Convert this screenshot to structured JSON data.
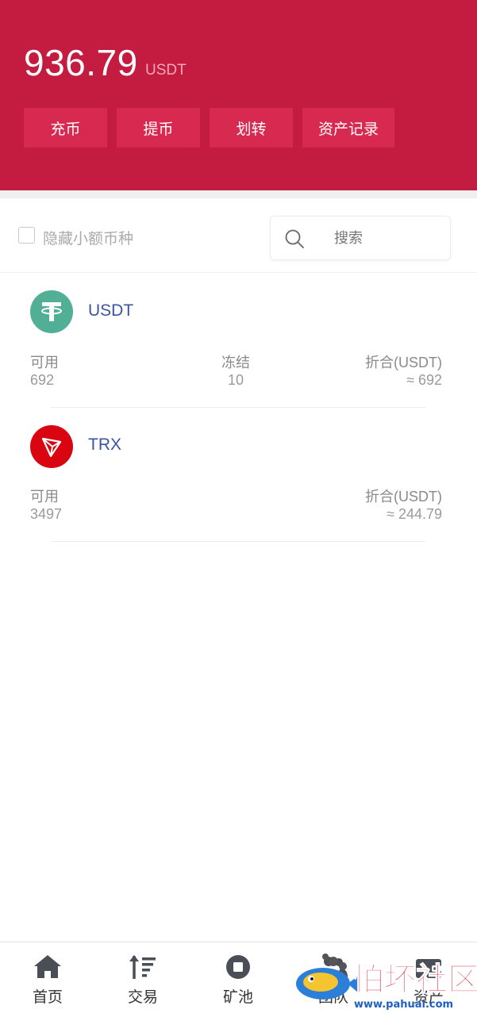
{
  "header": {
    "balance": "936.79",
    "balance_unit": "USDT",
    "buttons": [
      {
        "label": "充币"
      },
      {
        "label": "提币"
      },
      {
        "label": "划转"
      },
      {
        "label": "资产记录"
      }
    ]
  },
  "filter": {
    "hide_small_label": "隐藏小额币种",
    "search_placeholder": "搜索"
  },
  "assets": [
    {
      "name": "USDT",
      "available_label": "可用",
      "available": "692",
      "frozen_label": "冻结",
      "frozen": "10",
      "equiv_label": "折合(USDT)",
      "equiv": "≈ 692"
    },
    {
      "name": "TRX",
      "available_label": "可用",
      "available": "3497",
      "equiv_label": "折合(USDT)",
      "equiv": "≈ 244.79"
    }
  ],
  "tabbar": {
    "items": [
      {
        "label": "首页",
        "icon": "home-icon"
      },
      {
        "label": "交易",
        "icon": "sort-icon"
      },
      {
        "label": "矿池",
        "icon": "stop-circle-icon"
      },
      {
        "label": "团队",
        "icon": "team-icon"
      },
      {
        "label": "资产",
        "icon": "wallet-icon"
      }
    ]
  },
  "watermark": {
    "text": "怕坏社区",
    "url": "www.pahuai.com"
  },
  "colors": {
    "header_bg": "#c41b40",
    "button_bg": "#d82a50",
    "usdt_green": "#50af95",
    "trx_red": "#d90511",
    "coin_name": "#3c54a0"
  }
}
